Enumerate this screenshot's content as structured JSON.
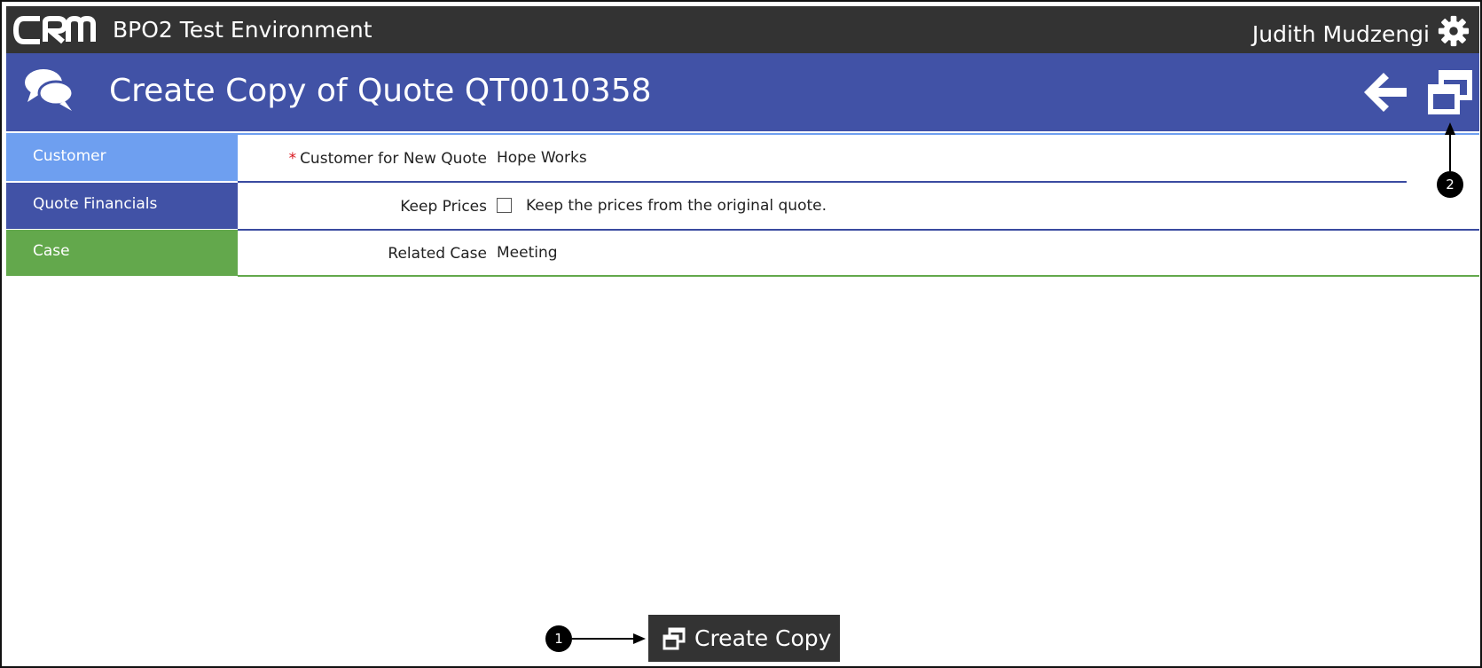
{
  "app": {
    "environment_title": "BPO2 Test Environment",
    "user_name": "Judith Mudzengi"
  },
  "header": {
    "title": "Create Copy of Quote QT0010358"
  },
  "sections": [
    {
      "label": "Customer"
    },
    {
      "label": "Quote Financials"
    },
    {
      "label": "Case"
    }
  ],
  "fields": {
    "customer": {
      "required_mark": "*",
      "label": "Customer for New Quote",
      "value": "Hope Works"
    },
    "keep_prices": {
      "label": "Keep Prices",
      "checked": false,
      "description": "Keep the prices from the original quote."
    },
    "related_case": {
      "label": "Related Case",
      "value": "Meeting"
    }
  },
  "actions": {
    "create_copy_label": "Create Copy"
  },
  "callouts": [
    "1",
    "2"
  ],
  "colors": {
    "topbar": "#333333",
    "header": "#4152a6",
    "customer_tab": "#6e9ff0",
    "financials_tab": "#4152a6",
    "case_tab": "#63a84c",
    "required": "#d9141c"
  },
  "icons": [
    "crm-logo",
    "gear-icon",
    "chat-bubbles-icon",
    "back-arrow-icon",
    "copy-window-icon"
  ]
}
